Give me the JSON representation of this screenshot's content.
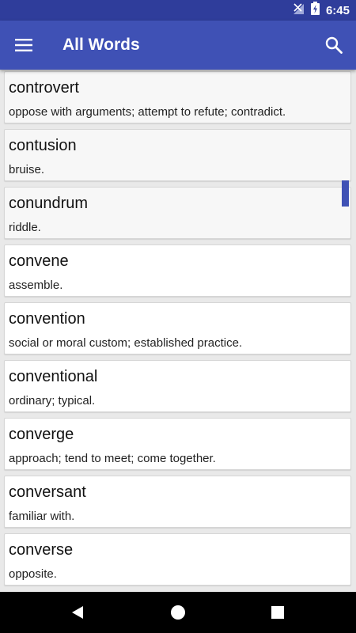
{
  "status_bar": {
    "time": "6:45",
    "icons": [
      "no-signal-icon",
      "battery-charging-icon"
    ]
  },
  "app_bar": {
    "title": "All Words",
    "menu_icon": "hamburger-menu-icon",
    "search_icon": "search-icon"
  },
  "words": [
    {
      "word": "controvert",
      "definition": "oppose with arguments; attempt to refute; contradict."
    },
    {
      "word": "contusion",
      "definition": "bruise."
    },
    {
      "word": "conundrum",
      "definition": "riddle."
    },
    {
      "word": "convene",
      "definition": "assemble."
    },
    {
      "word": "convention",
      "definition": "social or moral custom; established practice."
    },
    {
      "word": "conventional",
      "definition": "ordinary; typical."
    },
    {
      "word": "converge",
      "definition": "approach; tend to meet; come together."
    },
    {
      "word": "conversant",
      "definition": "familiar with."
    },
    {
      "word": "converse",
      "definition": "opposite."
    }
  ],
  "nav_bar": {
    "icons": [
      "back-icon",
      "home-icon",
      "recents-icon"
    ]
  },
  "colors": {
    "status_bar": "#2f3d9b",
    "app_bar": "#3f51b5",
    "accent": "#3f51b5",
    "list_background": "#e9e9e9"
  }
}
